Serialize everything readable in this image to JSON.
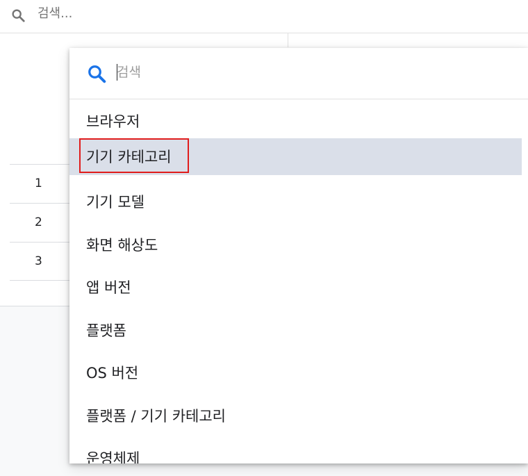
{
  "top_search": {
    "placeholder": "검색..."
  },
  "table": {
    "rows": [
      "1",
      "2",
      "3"
    ]
  },
  "dropdown": {
    "search_placeholder": "검색",
    "items": [
      {
        "label": "브라우저"
      },
      {
        "label": "기기 카테고리"
      },
      {
        "label": "기기 모델"
      },
      {
        "label": "화면 해상도"
      },
      {
        "label": "앱 버전"
      },
      {
        "label": "플랫폼"
      },
      {
        "label": "OS 버전"
      },
      {
        "label": "플랫폼 / 기기 카테고리"
      },
      {
        "label": "운영체제"
      }
    ],
    "selected_index": 1
  },
  "colors": {
    "accent": "#1a73e8",
    "selected_bg": "#dadfe9",
    "highlight_border": "#e01c1c"
  },
  "icons": {
    "top_search": "search-icon",
    "dropdown_search": "search-icon"
  }
}
